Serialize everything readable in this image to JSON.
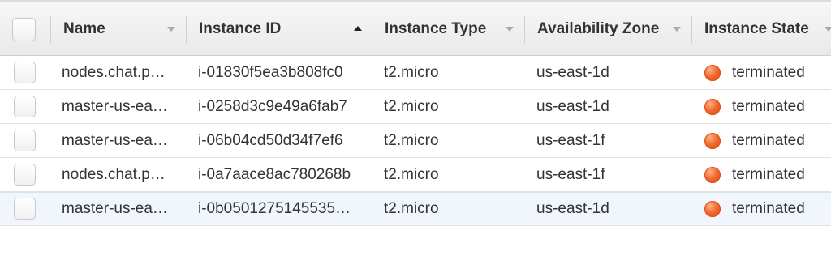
{
  "columns": {
    "name": "Name",
    "instance_id": "Instance ID",
    "instance_type": "Instance Type",
    "availability_zone": "Availability Zone",
    "instance_state": "Instance State"
  },
  "sort": {
    "column": "Instance ID",
    "direction": "ascending"
  },
  "state_color": "#f26a2e",
  "rows": [
    {
      "name": "nodes.chat.p…",
      "instance_id": "i-01830f5ea3b808fc0",
      "instance_type": "t2.micro",
      "availability_zone": "us-east-1d",
      "instance_state": "terminated"
    },
    {
      "name": "master-us-ea…",
      "instance_id": "i-0258d3c9e49a6fab7",
      "instance_type": "t2.micro",
      "availability_zone": "us-east-1d",
      "instance_state": "terminated"
    },
    {
      "name": "master-us-ea…",
      "instance_id": "i-06b04cd50d34f7ef6",
      "instance_type": "t2.micro",
      "availability_zone": "us-east-1f",
      "instance_state": "terminated"
    },
    {
      "name": "nodes.chat.p…",
      "instance_id": "i-0a7aace8ac780268b",
      "instance_type": "t2.micro",
      "availability_zone": "us-east-1f",
      "instance_state": "terminated"
    },
    {
      "name": "master-us-ea…",
      "instance_id": "i-0b0501275145535…",
      "instance_type": "t2.micro",
      "availability_zone": "us-east-1d",
      "instance_state": "terminated"
    }
  ]
}
